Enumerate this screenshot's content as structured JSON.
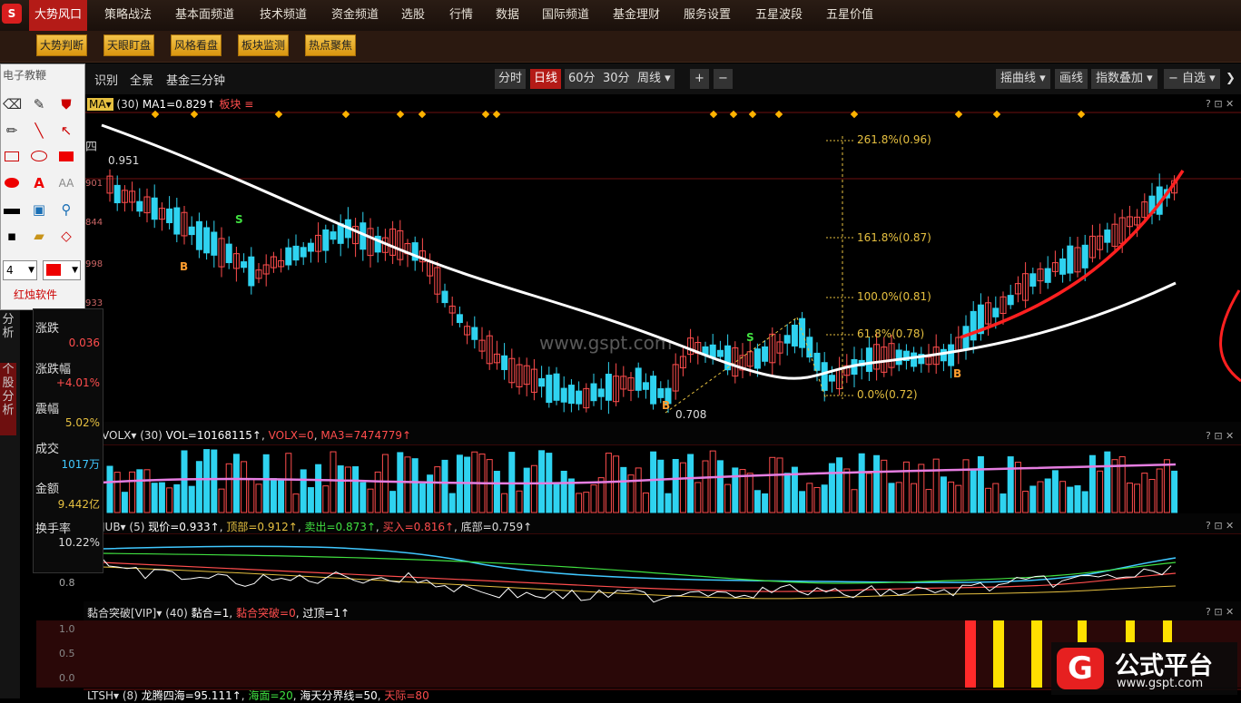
{
  "nav": {
    "logo": "S",
    "items": [
      "大势风口",
      "策略战法",
      "基本面频道",
      "技术频道",
      "资金频道",
      "选股",
      "行情",
      "数据",
      "国际频道",
      "基金理财",
      "服务设置",
      "五星波段",
      "五星价值"
    ]
  },
  "subbar": [
    "大势判断",
    "天眼盯盘",
    "风格看盘",
    "板块监测",
    "热点聚焦"
  ],
  "toolrow": {
    "links": [
      "识别",
      "全景",
      "基金三分钟"
    ],
    "periods": [
      "分时",
      "日线",
      "60分",
      "30分",
      "周线 ▾"
    ],
    "zoom_in": "+",
    "zoom_out": "−",
    "right": [
      "摇曲线 ▾",
      "画线",
      "指数叠加 ▾",
      "− 自选 ▾"
    ],
    "collapse": "❯"
  },
  "drawpanel": {
    "title": "电子教鞭",
    "line_width": "4",
    "brand": "红烛软件"
  },
  "left_tabs": [
    "分析",
    "个股分析"
  ],
  "info": [
    {
      "label": "涨跌",
      "value": "0.036",
      "color": "#ff4d4d"
    },
    {
      "label": "涨跌幅",
      "value": "+4.01%",
      "color": "#ff4d4d"
    },
    {
      "label": "震幅",
      "value": "5.02%",
      "color": "#e6c040"
    },
    {
      "label": "成交",
      "value": "1017万",
      "color": "#40c8ff"
    },
    {
      "label": "金额",
      "value": "9.442亿",
      "color": "#e6c040"
    },
    {
      "label": "换手率",
      "value": "10.22%",
      "color": "#dddddd"
    }
  ],
  "main": {
    "indicator": "MA▾",
    "period": "(30)",
    "ma1": "MA1=0.829↑",
    "block": "板块 ≡",
    "price_high": "0.951",
    "price_low": "0.708",
    "axis_labels": [
      "四",
      "901",
      "844",
      "998",
      "933"
    ],
    "fib": [
      {
        "label": "261.8%(0.96)",
        "value": 0.96
      },
      {
        "label": "161.8%(0.87)",
        "value": 0.87
      },
      {
        "label": "100.0%(0.81)",
        "value": 0.81
      },
      {
        "label": "61.8%(0.78)",
        "value": 0.78
      },
      {
        "label": "0.0%(0.72)",
        "value": 0.72
      }
    ],
    "watermark_text": "www.gspt.com",
    "signals": [
      {
        "t": "S",
        "color": "#40e040"
      },
      {
        "t": "B",
        "color": "#ff9d2e"
      },
      {
        "t": "B",
        "color": "#ff9d2e"
      },
      {
        "t": "S",
        "color": "#40e040"
      },
      {
        "t": "B",
        "color": "#ff9d2e"
      }
    ]
  },
  "vol": {
    "name": "VOLX▾",
    "period": "(30)",
    "vol": "VOL=10168115↑",
    "volx": "VOLX=0",
    "ma3": "MA3=7474779↑"
  },
  "sub": {
    "name": "JUB▾",
    "period": "(5)",
    "price": "现价=0.933↑",
    "top": "顶部=0.912↑",
    "sell": "卖出=0.873↑",
    "buy": "买入=0.816↑",
    "bottom": "底部=0.759↑",
    "axis": "0.8"
  },
  "nian": {
    "name": "黏合突破[VIP]▾",
    "period": "(40)",
    "a": "黏合=1",
    "b": "黏合突破=0",
    "c": "过顶=1↑",
    "axis": [
      "1.0",
      "0.5",
      "0.0"
    ]
  },
  "bottom": {
    "name": "LTSH▾",
    "period": "(8)",
    "a": "龙腾四海=95.111↑",
    "b": "海面=20",
    "c": "海天分界线=50",
    "d": "天际=80"
  },
  "brand": {
    "name": "公式平台",
    "url": "www.gspt.com"
  },
  "win_icons": "? ⊡ ✕",
  "colors": {
    "up": "#ff4d4d",
    "down": "#2fd3f0",
    "accent": "#b41b17",
    "ma": "#ffffff",
    "trend": "#ff2020",
    "fib": "#e6c040"
  }
}
